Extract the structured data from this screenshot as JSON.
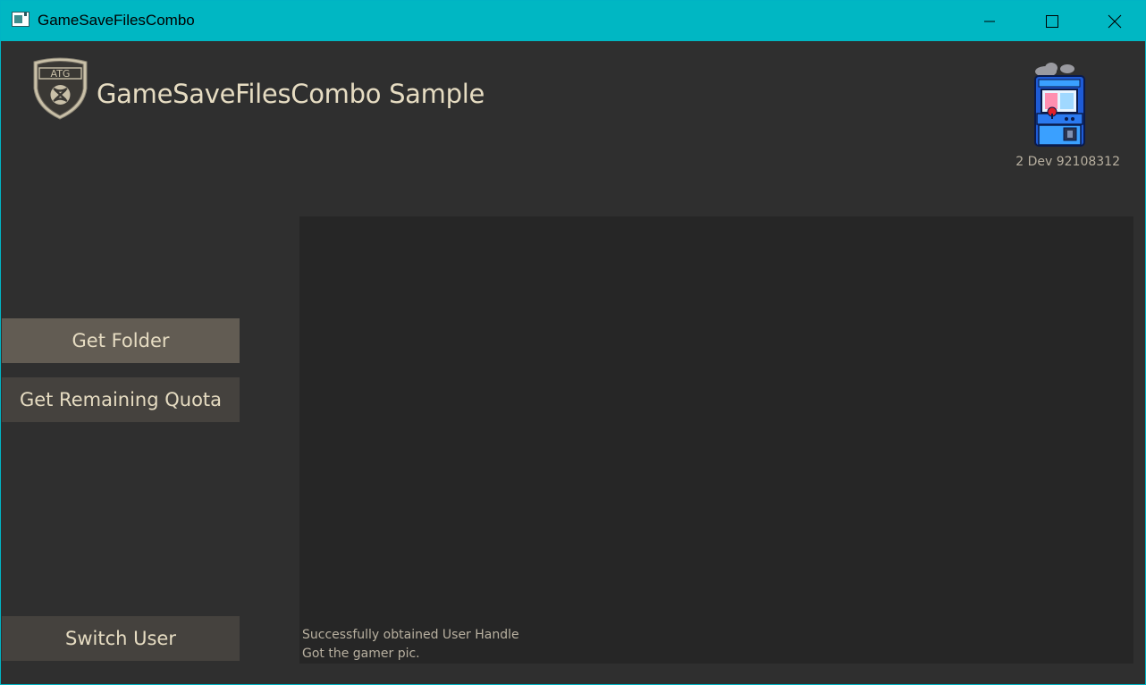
{
  "window": {
    "title": "GameSaveFilesCombo"
  },
  "header": {
    "title": "GameSaveFilesCombo Sample",
    "logo_text": "ATG"
  },
  "user": {
    "gamertag": "2 Dev 92108312"
  },
  "buttons": {
    "get_folder": "Get Folder",
    "get_remaining_quota": "Get Remaining Quota",
    "switch_user": "Switch User"
  },
  "log": {
    "lines": [
      "Successfully obtained User Handle",
      "Got the gamer pic."
    ]
  },
  "colors": {
    "titlebar": "#00b7c3",
    "background": "#2f2f2f",
    "log_panel": "#262626",
    "button_selected": "#625c53",
    "button_default": "#45423e",
    "text": "#e6dcc2"
  }
}
